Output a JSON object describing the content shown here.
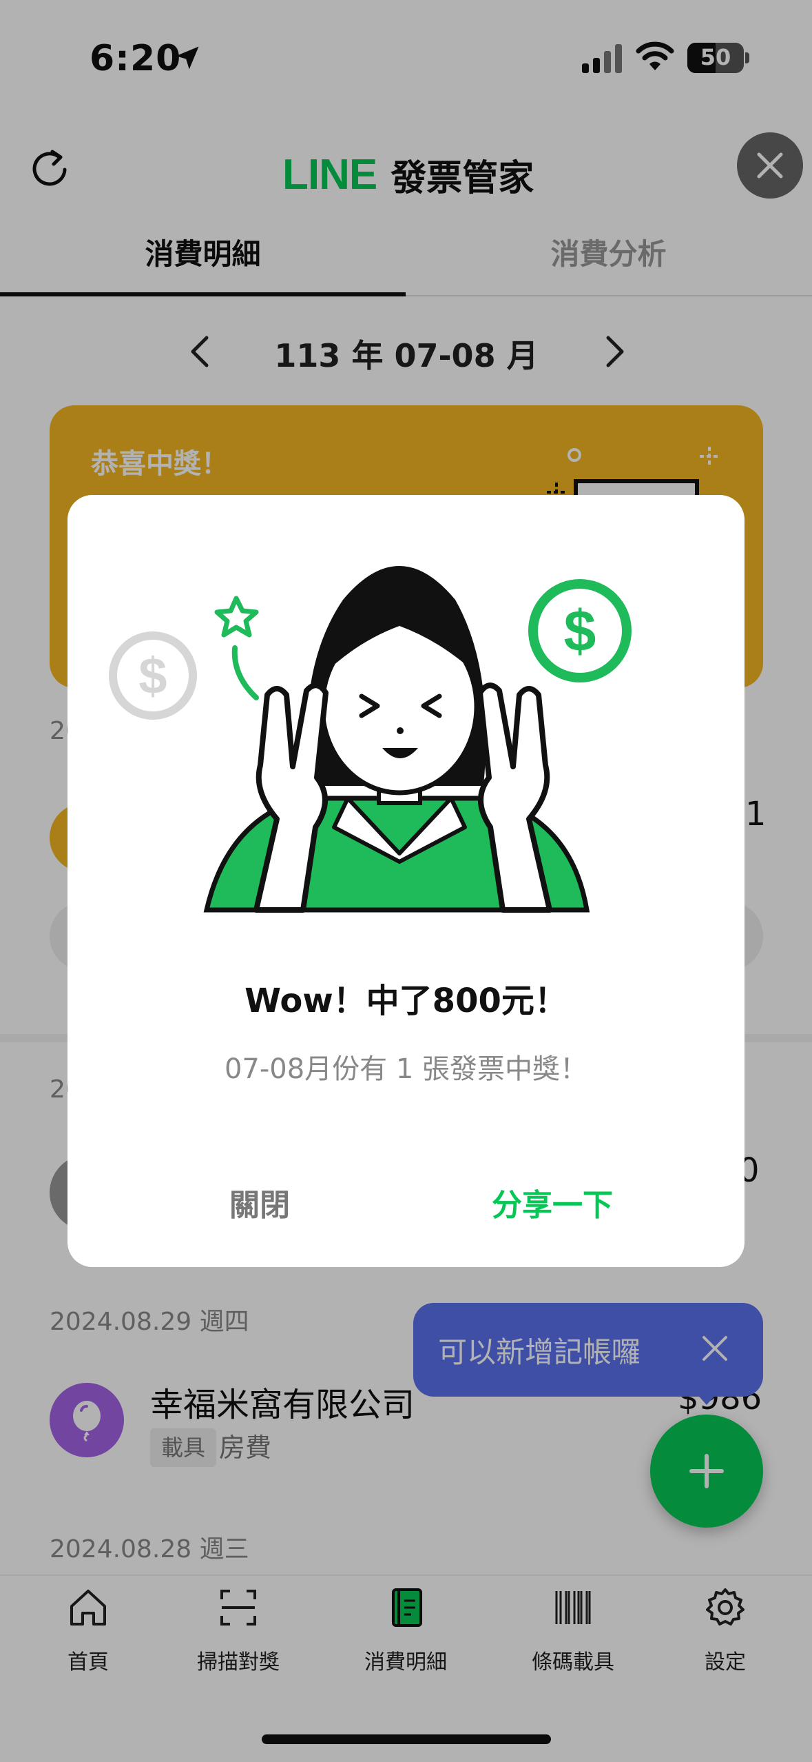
{
  "status_bar": {
    "time": "6:20",
    "battery_level": "50"
  },
  "header": {
    "brand_line": "LINE",
    "brand_title": "發票管家"
  },
  "tabs": [
    {
      "label": "消費明細",
      "active": true
    },
    {
      "label": "消費分析",
      "active": false
    }
  ],
  "month_nav": {
    "label": "113 年 07-08 月"
  },
  "win_card": {
    "label": "恭喜中獎！"
  },
  "background": {
    "date_partial_1": "20",
    "amount_partial_1": "1",
    "date_partial_2": "20",
    "amount_partial_2": "0"
  },
  "transactions": [
    {
      "date": "2024.08.29 週四",
      "merchant": "幸福米窩有限公司",
      "tag": "載具",
      "category": "房費",
      "amount": "$986"
    }
  ],
  "next_date": "2024.08.28 週三",
  "tooltip": {
    "text": "可以新增記帳囉"
  },
  "bottom_nav": [
    {
      "label": "首頁",
      "icon": "home-icon"
    },
    {
      "label": "掃描對獎",
      "icon": "scan-icon"
    },
    {
      "label": "消費明細",
      "icon": "ledger-icon"
    },
    {
      "label": "條碼載具",
      "icon": "barcode-icon"
    },
    {
      "label": "設定",
      "icon": "gear-icon"
    }
  ],
  "modal": {
    "title": "Wow！中了800元！",
    "subtitle": "07-08月份有 1 張發票中獎！",
    "close_label": "關閉",
    "share_label": "分享一下"
  },
  "colors": {
    "brand_green": "#06c755",
    "win_card": "#f4b722",
    "tooltip_blue": "#5b72ee",
    "avatar_purple": "#a463e6"
  }
}
